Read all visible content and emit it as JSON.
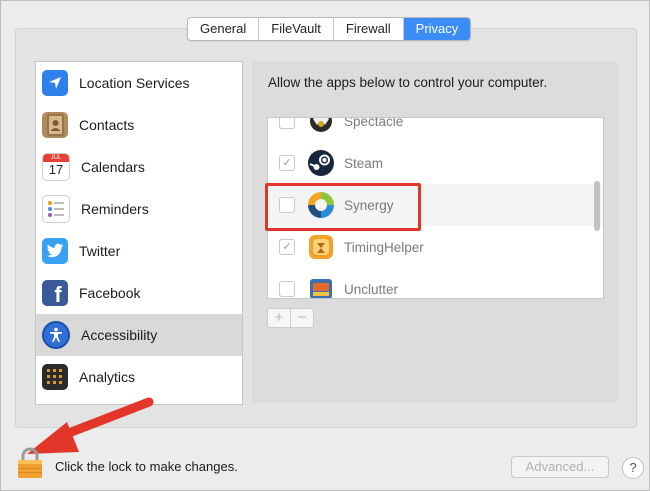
{
  "tabs": [
    "General",
    "FileVault",
    "Firewall",
    "Privacy"
  ],
  "active_tab": "Privacy",
  "sidebar": {
    "items": [
      {
        "label": "Location Services",
        "icon": "location-arrow-icon"
      },
      {
        "label": "Contacts",
        "icon": "contacts-book-icon"
      },
      {
        "label": "Calendars",
        "icon": "calendar-icon"
      },
      {
        "label": "Reminders",
        "icon": "reminders-list-icon"
      },
      {
        "label": "Twitter",
        "icon": "twitter-bird-icon"
      },
      {
        "label": "Facebook",
        "icon": "facebook-f-icon"
      },
      {
        "label": "Accessibility",
        "icon": "accessibility-person-icon"
      },
      {
        "label": "Analytics",
        "icon": "analytics-dots-icon"
      }
    ],
    "selected": "Accessibility",
    "calendar_month": "JUL",
    "calendar_day": "17"
  },
  "panel": {
    "title": "Allow the apps below to control your computer.",
    "apps": [
      {
        "name": "Spectacle",
        "checked": false,
        "icon": "spectacle-icon"
      },
      {
        "name": "Steam",
        "checked": true,
        "icon": "steam-icon"
      },
      {
        "name": "Synergy",
        "checked": false,
        "icon": "synergy-icon"
      },
      {
        "name": "TimingHelper",
        "checked": true,
        "icon": "timinghelper-icon"
      },
      {
        "name": "Unclutter",
        "checked": false,
        "icon": "unclutter-icon"
      }
    ],
    "add_label": "+",
    "remove_label": "−"
  },
  "footer": {
    "lock_text": "Click the lock to make changes.",
    "advanced_label": "Advanced...",
    "help_label": "?"
  },
  "colors": {
    "accent": "#3b8cf5",
    "annotation": "#e2362b"
  }
}
